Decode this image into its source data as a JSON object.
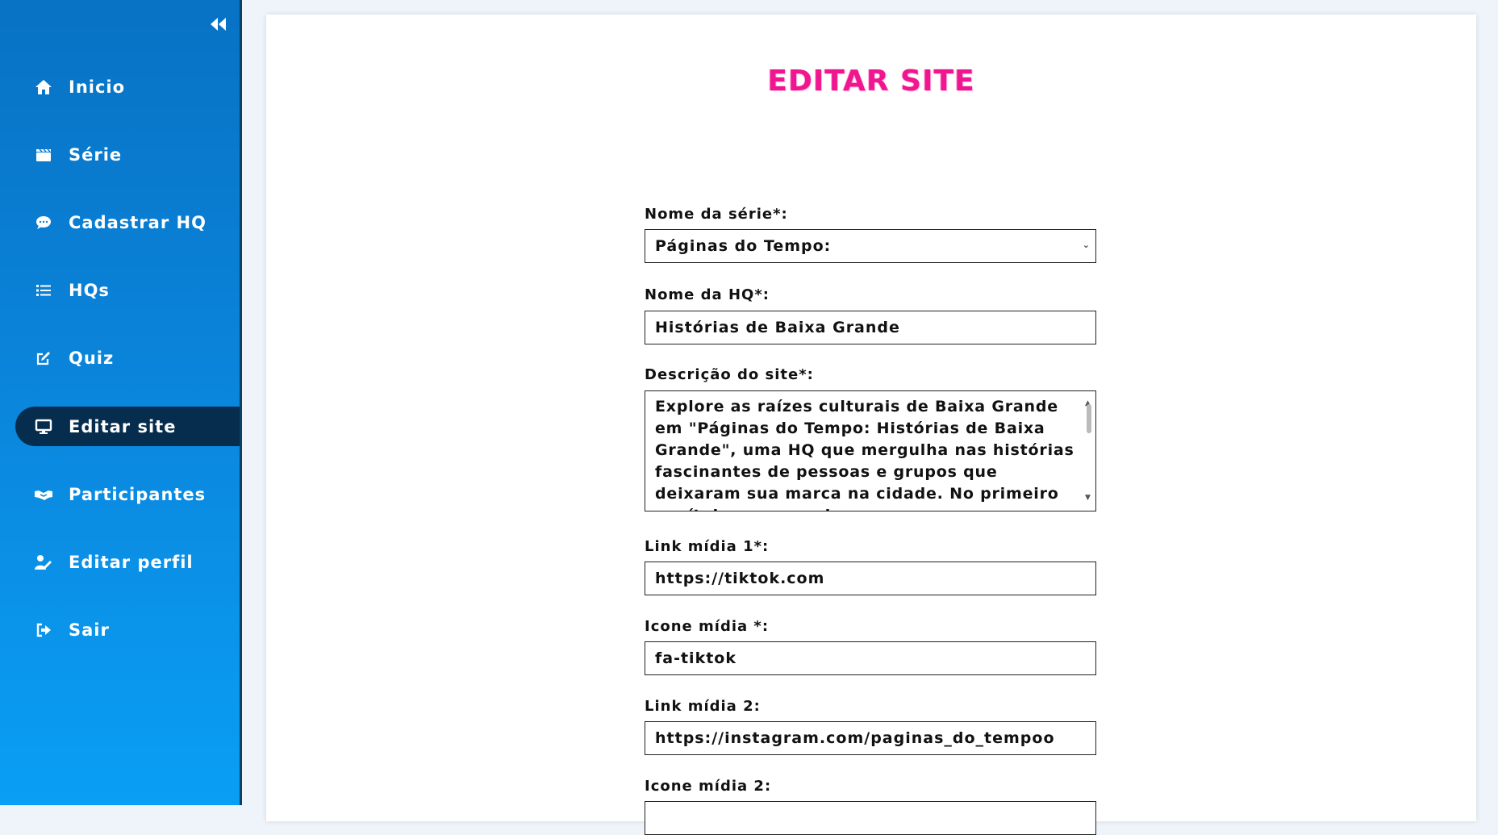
{
  "sidebar": {
    "collapse_icon": "double-chevron-left-icon",
    "items": [
      {
        "label": "Inicio",
        "icon": "home-icon",
        "active": false
      },
      {
        "label": "Série",
        "icon": "clapperboard-icon",
        "active": false
      },
      {
        "label": "Cadastrar HQ",
        "icon": "speech-bubble-icon",
        "active": false
      },
      {
        "label": "HQs",
        "icon": "list-icon",
        "active": false
      },
      {
        "label": "Quiz",
        "icon": "edit-icon",
        "active": false
      },
      {
        "label": "Editar site",
        "icon": "monitor-icon",
        "active": true
      },
      {
        "label": "Participantes",
        "icon": "handshake-icon",
        "active": false
      },
      {
        "label": "Editar perfil",
        "icon": "user-edit-icon",
        "active": false
      },
      {
        "label": "Sair",
        "icon": "sign-out-icon",
        "active": false
      }
    ]
  },
  "page": {
    "title": "EDITAR SITE"
  },
  "form": {
    "serie": {
      "label": "Nome da série*:",
      "value": "Páginas do Tempo:"
    },
    "hq": {
      "label": "Nome da HQ*:",
      "value": "Histórias de Baixa Grande"
    },
    "descricao": {
      "label": "Descrição do site*:",
      "value": "Explore as raízes culturais de Baixa Grande em \"Páginas do Tempo: Histórias de Baixa Grande\", uma HQ que mergulha nas histórias fascinantes de pessoas e grupos que deixaram sua marca na cidade. No primeiro capítulo, acompanhe"
    },
    "link1": {
      "label": "Link mídia 1*:",
      "value": "https://tiktok.com"
    },
    "icone1": {
      "label": "Icone mídia *:",
      "value": "fa-tiktok"
    },
    "link2": {
      "label": "Link mídia 2:",
      "value": "https://instagram.com/paginas_do_tempoo"
    },
    "icone2": {
      "label": "Icone mídia 2:",
      "value": ""
    }
  },
  "colors": {
    "sidebar_top": "#0872c4",
    "sidebar_bottom": "#099ff5",
    "active_item": "#062d4d",
    "title_pink": "#f0168f"
  }
}
